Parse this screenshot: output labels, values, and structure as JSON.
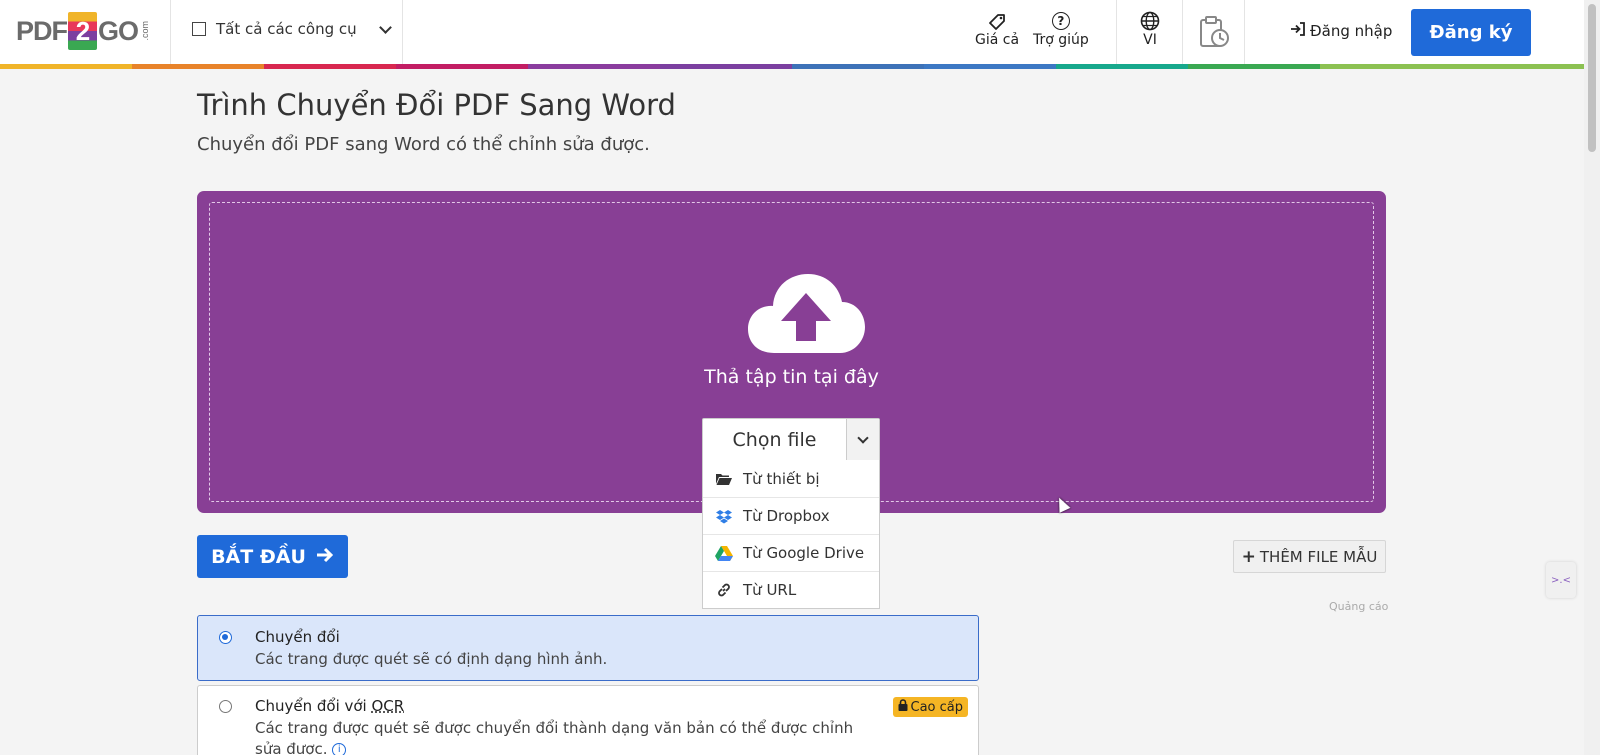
{
  "header": {
    "logo": {
      "prefix": "PDF",
      "two": "2",
      "suffix": "GO",
      "dotcom": ".com"
    },
    "tools_label": "Tất cả các công cụ",
    "pricing_label": "Giá cả",
    "help_label": "Trợ giúp",
    "language_label": "VI",
    "login_label": "Đăng nhập",
    "signup_label": "Đăng ký",
    "color_bar": [
      "#f0b429",
      "#e8832a",
      "#d8274f",
      "#c21d63",
      "#8a3c9e",
      "#7b3fa0",
      "#3d72b8",
      "#3c78c4",
      "#17a88c",
      "#3aa852",
      "#8cc152",
      "#8cc152"
    ]
  },
  "page": {
    "title": "Trình Chuyển Đổi PDF Sang Word",
    "subtitle": "Chuyển đổi PDF sang Word có thể chỉnh sửa được."
  },
  "dropzone": {
    "drop_text": "Thả tập tin tại đây",
    "choose_file_label": "Chọn file",
    "menu": [
      {
        "icon": "folder-open-icon",
        "label": "Từ thiết bị"
      },
      {
        "icon": "dropbox-icon",
        "label": "Từ Dropbox"
      },
      {
        "icon": "google-drive-icon",
        "label": "Từ Google Drive"
      },
      {
        "icon": "link-icon",
        "label": "Từ URL"
      }
    ],
    "bg_color": "#883f95"
  },
  "actions": {
    "start_label": "BẮT ĐẦU",
    "add_sample_label": "THÊM FILE MẪU",
    "ad_label": "Quảng cáo"
  },
  "options": [
    {
      "title": "Chuyển đổi",
      "description": "Các trang được quét sẽ có định dạng hình ảnh.",
      "selected": true
    },
    {
      "title_prefix": "Chuyển đổi với ",
      "title_abbr": "OCR",
      "description": "Các trang được quét sẽ được chuyển đổi thành dạng văn bản có thể được chỉnh sửa được.",
      "selected": false,
      "badge": "Cao cấp"
    }
  ],
  "side_widget": {
    "label": ">.<"
  },
  "colors": {
    "primary": "#1f6ad9",
    "premium": "#f5b524"
  }
}
